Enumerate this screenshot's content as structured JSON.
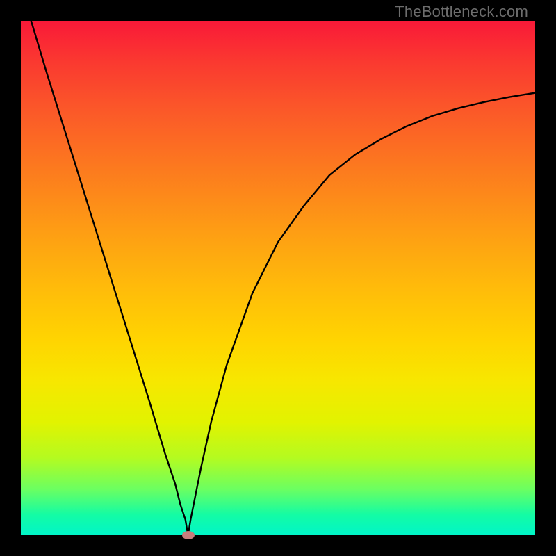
{
  "watermark": "TheBottleneck.com",
  "chart_data": {
    "type": "line",
    "title": "",
    "xlabel": "",
    "ylabel": "",
    "xlim": [
      0,
      100
    ],
    "ylim": [
      0,
      100
    ],
    "grid": false,
    "series": [
      {
        "name": "curve",
        "color": "#000000",
        "x": [
          2,
          5,
          10,
          15,
          20,
          25,
          28,
          30,
          31,
          32,
          32.5,
          33,
          34,
          35,
          37,
          40,
          45,
          50,
          55,
          60,
          65,
          70,
          75,
          80,
          85,
          90,
          95,
          100
        ],
        "values": [
          100,
          90,
          74,
          58,
          42,
          26,
          16,
          10,
          6,
          3,
          0,
          3,
          8,
          13,
          22,
          33,
          47,
          57,
          64,
          70,
          74,
          77,
          79.5,
          81.5,
          83,
          84.2,
          85.2,
          86
        ]
      }
    ],
    "marker": {
      "x": 32.5,
      "y": 0,
      "color": "#c77d7d"
    },
    "background_gradient": {
      "top": "#f91938",
      "middle": "#ffd401",
      "bottom": "#00f5c8"
    }
  }
}
